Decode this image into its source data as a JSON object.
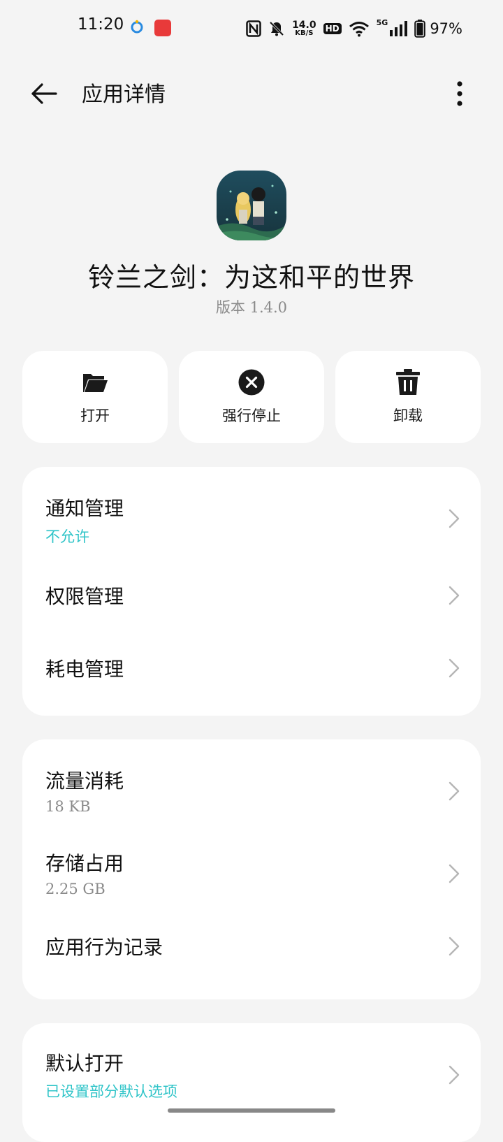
{
  "status_bar": {
    "time": "11:20",
    "net_speed": "14.0",
    "net_speed_unit": "KB/S",
    "hd_label": "HD",
    "network_type": "5G",
    "battery": "97%"
  },
  "header": {
    "title": "应用详情"
  },
  "app": {
    "name": "铃兰之剑：为这和平的世界",
    "version": "版本 1.4.0"
  },
  "actions": [
    {
      "label": "打开",
      "icon": "folder-open-icon"
    },
    {
      "label": "强行停止",
      "icon": "close-circle-icon"
    },
    {
      "label": "卸载",
      "icon": "trash-icon"
    }
  ],
  "group1": [
    {
      "title": "通知管理",
      "subtitle": "不允许"
    },
    {
      "title": "权限管理"
    },
    {
      "title": "耗电管理"
    }
  ],
  "group2": [
    {
      "title": "流量消耗",
      "subtitle": "18 KB"
    },
    {
      "title": "存储占用",
      "subtitle": "2.25 GB"
    },
    {
      "title": "应用行为记录"
    }
  ],
  "group3": [
    {
      "title": "默认打开",
      "subtitle": "已设置部分默认选项"
    }
  ],
  "colors": {
    "accent": "#2fc4c8",
    "background": "#f4f4f4",
    "card": "#ffffff"
  }
}
